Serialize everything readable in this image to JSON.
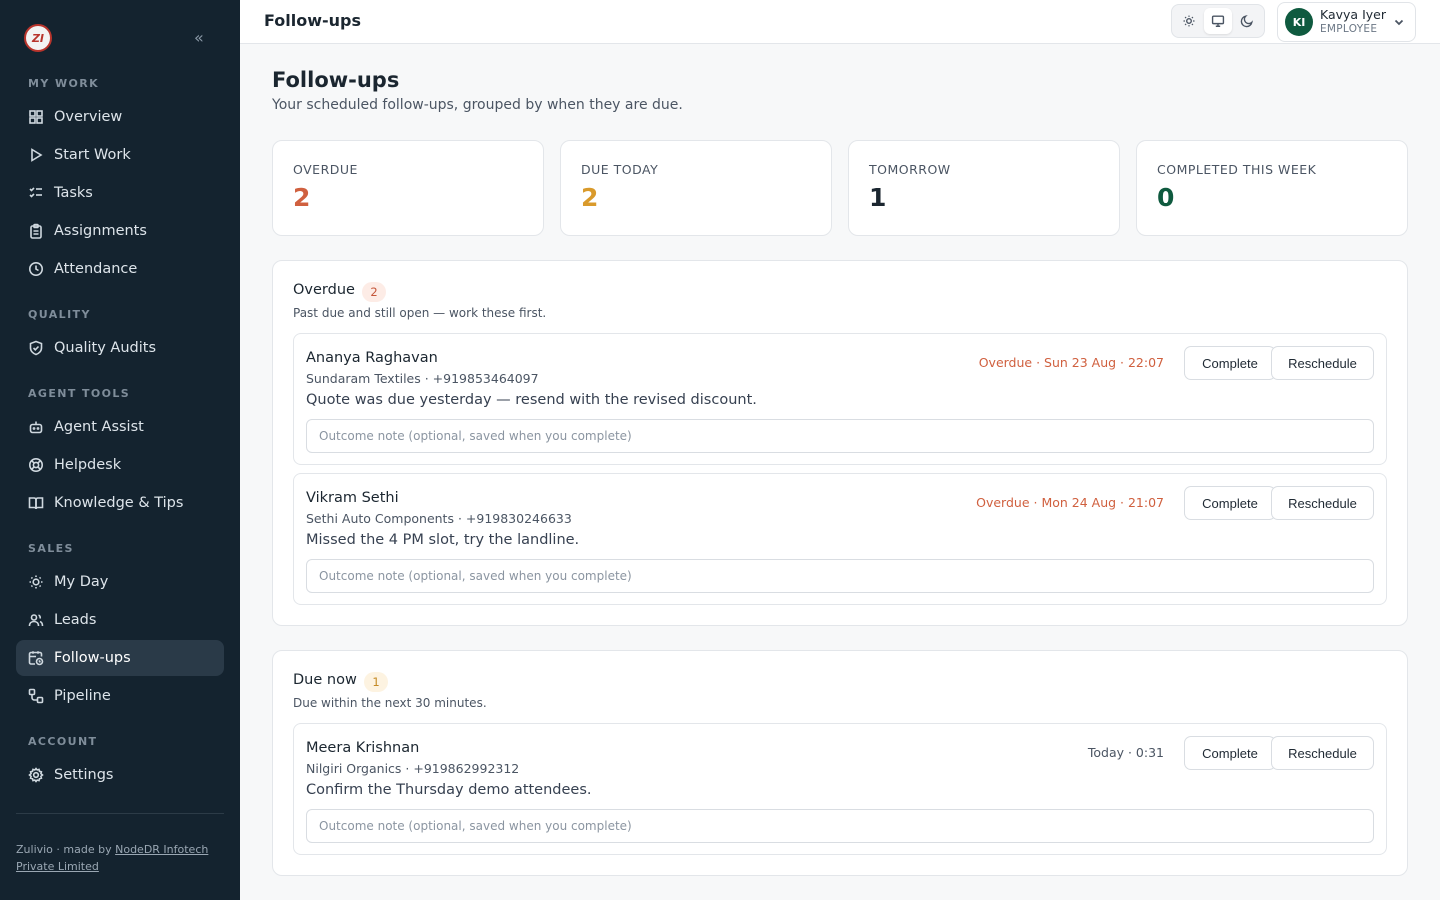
{
  "sidebar": {
    "logo_text": "ZI",
    "collapse_glyph": "«",
    "sections": [
      {
        "label": "MY WORK"
      },
      {
        "label": "QUALITY"
      },
      {
        "label": "AGENT TOOLS"
      },
      {
        "label": "SALES"
      },
      {
        "label": "ACCOUNT"
      }
    ],
    "items": [
      {
        "label": "Overview",
        "icon": "grid-icon"
      },
      {
        "label": "Start Work",
        "icon": "play-icon"
      },
      {
        "label": "Tasks",
        "icon": "checklist-icon"
      },
      {
        "label": "Assignments",
        "icon": "clipboard-icon"
      },
      {
        "label": "Attendance",
        "icon": "clock-icon"
      },
      {
        "label": "Quality Audits",
        "icon": "shield-check-icon"
      },
      {
        "label": "Agent Assist",
        "icon": "bot-icon"
      },
      {
        "label": "Helpdesk",
        "icon": "lifebuoy-icon"
      },
      {
        "label": "Knowledge & Tips",
        "icon": "book-icon"
      },
      {
        "label": "My Day",
        "icon": "sun-icon"
      },
      {
        "label": "Leads",
        "icon": "users-icon"
      },
      {
        "label": "Follow-ups",
        "icon": "calendar-clock-icon",
        "active": true
      },
      {
        "label": "Pipeline",
        "icon": "workflow-icon"
      },
      {
        "label": "Settings",
        "icon": "gear-icon"
      }
    ],
    "footer_prefix": "Zulivio · made by ",
    "footer_link": "NodeDR Infotech Private Limited"
  },
  "topbar": {
    "title": "Follow-ups",
    "theme_modes": [
      "light",
      "system",
      "dark"
    ],
    "theme_selected": "system",
    "user": {
      "initials": "KI",
      "name": "Kavya Iyer",
      "role": "EMPLOYEE"
    }
  },
  "page": {
    "title": "Follow-ups",
    "subtitle": "Your scheduled follow-ups, grouped by when they are due."
  },
  "stats": [
    {
      "label": "OVERDUE",
      "value": "2",
      "color": "#d0603f"
    },
    {
      "label": "DUE TODAY",
      "value": "2",
      "color": "#d99a2b"
    },
    {
      "label": "TOMORROW",
      "value": "1",
      "color": "#1b2630"
    },
    {
      "label": "COMPLETED THIS WEEK",
      "value": "0",
      "color": "#0f5a3f"
    }
  ],
  "groups": [
    {
      "title": "Overdue",
      "count": "2",
      "count_bg": "#fdece6",
      "count_color": "#c4563a",
      "description": "Past due and still open — work these first.",
      "items": [
        {
          "name": "Ananya Raghavan",
          "company": "Sundaram Textiles · +919853464097",
          "note": "Quote was due yesterday — resend with the revised discount.",
          "due": "Overdue · Sun 23 Aug · 22:07",
          "due_color": "#d0603f"
        },
        {
          "name": "Vikram Sethi",
          "company": "Sethi Auto Components · +919830246633",
          "note": "Missed the 4 PM slot, try the landline.",
          "due": "Overdue · Mon 24 Aug · 21:07",
          "due_color": "#d0603f"
        }
      ]
    },
    {
      "title": "Due now",
      "count": "1",
      "count_bg": "#fdf3e1",
      "count_color": "#c48a25",
      "description": "Due within the next 30 minutes.",
      "items": [
        {
          "name": "Meera Krishnan",
          "company": "Nilgiri Organics · +919862992312",
          "note": "Confirm the Thursday demo attendees.",
          "due": "Today · 0:31",
          "due_color": "#4b5563"
        }
      ]
    }
  ],
  "actions": {
    "complete_label": "Complete",
    "reschedule_label": "Reschedule",
    "note_placeholder": "Outcome note (optional, saved when you complete)"
  }
}
